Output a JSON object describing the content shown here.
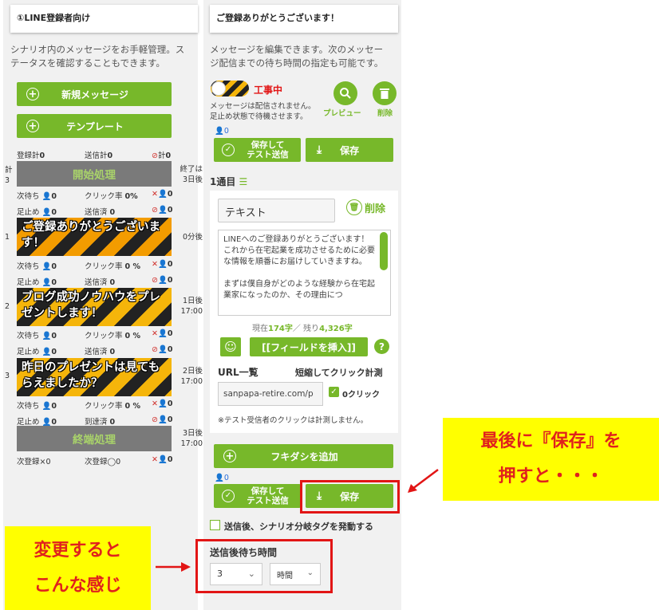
{
  "left": {
    "card_title": "①LINE登録者向け",
    "desc1": "シナリオ内のメッセージをお手軽管理。ス",
    "desc2": "テータスを確認することもできます。",
    "new_msg": "新規メッセージ",
    "template": "テンプレート",
    "reg_total": "登録計",
    "reg_total_v": "0",
    "sent_total": "送信計",
    "sent_total_v": "0",
    "block_total": "計",
    "block_total_v": "0",
    "side_kei": "計",
    "side_3": "3",
    "start": "開始処理",
    "end_label1": "終了は",
    "end_label2": "3日後",
    "next_wait": "次待ち",
    "click_rate": "クリック率",
    "rate0": "0%",
    "rate0s": "0 %",
    "stop": "足止め",
    "sent_done": "送信済",
    "zero": "0",
    "arrived": "到達済",
    "m1": "ご登録ありがとうございます！",
    "m1_num": "1",
    "m1_time": "0分後",
    "m2": "ブログ成功ノウハウをプレゼントします！",
    "m2_num": "2",
    "m2_time1": "1日後",
    "m2_time2": "17:00",
    "m3": "昨日のプレゼントは見てもらえましたか？",
    "m3_num": "3",
    "m3_time1": "2日後",
    "m3_time2": "17:00",
    "end": "終端処理",
    "end_time1": "3日後",
    "end_time2": "17:00",
    "next_reg": "次登録×",
    "next_reg_v": "0",
    "next_reg2": "次登録◯",
    "next_reg2_v": "0"
  },
  "right": {
    "card_title": "ご登録ありがとうございます！",
    "desc1": "メッセージを編集できます。次のメッセー",
    "desc2": "ジ配信までの待ち時間の指定も可能です。",
    "construction": "工事中",
    "status1": "メッセージは配信されません。",
    "status2": "足止め状態で待機させます。",
    "preview": "プレビュー",
    "delete": "削除",
    "count": "0",
    "save_test1": "保存して",
    "save_test2": "テスト送信",
    "save": "保存",
    "item": "1通目",
    "text_type": "テキスト",
    "delete2": "削除",
    "message": "LINEへのご登録ありがとうございます！\nこれから在宅起業を成功させるために必要な情報を順番にお届けしていきますね。\n\nまずは僕自身がどのような経験から在宅起業家になったのか、その理由につ",
    "counter_pre": "現在",
    "counter_now": "174字",
    "counter_mid": "／ 残り",
    "counter_left": "4,326字",
    "insert_field": "[[フィールドを挿入]]",
    "url_label": "URL一覧",
    "shorten": "短縮してクリック計測",
    "url_value": "sanpapa-retire.com/p",
    "clicks": "0クリック",
    "note": "※テスト受信者のクリックは計測しません。",
    "add_bubble": "フキダシを追加",
    "count2": "0",
    "branch_tag": "送信後、シナリオ分岐タグを発動する",
    "wait_label": "送信後待ち時間",
    "wait_num": "3",
    "wait_unit": "時間"
  },
  "annot": {
    "c1a": "最後に『保存』を",
    "c1b": "押すと・・・",
    "c2a": "変更すると",
    "c2b": "こんな感じ"
  },
  "colors": {
    "green": "#77b82a",
    "red": "#e21515",
    "yellow": "#ffff00"
  }
}
